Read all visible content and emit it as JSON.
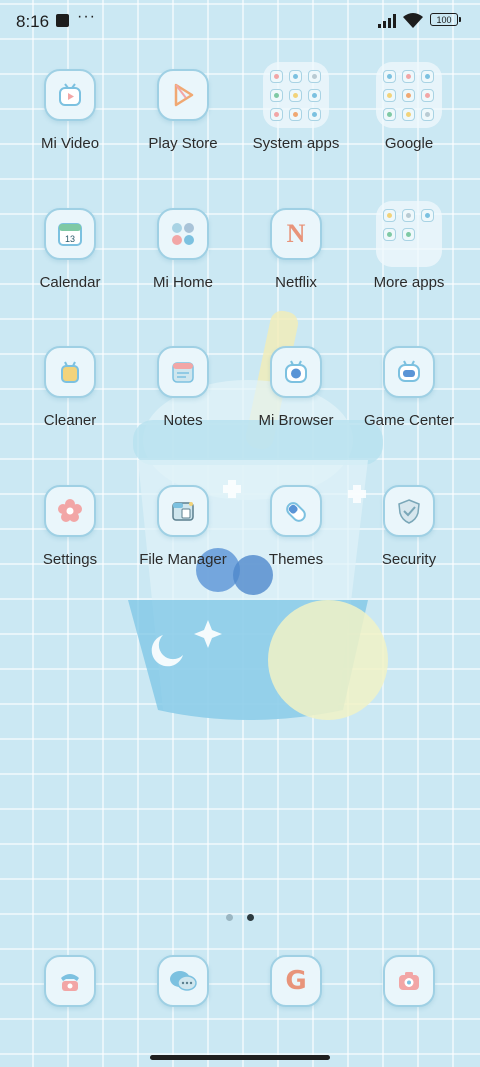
{
  "status_bar": {
    "time": "8:16",
    "more_glyph": "···",
    "battery": "100"
  },
  "home": {
    "rows": [
      [
        {
          "label": "Mi Video",
          "icon": "mi-video-icon"
        },
        {
          "label": "Play Store",
          "icon": "play-store-icon"
        },
        {
          "label": "System apps",
          "icon": "folder-icon"
        },
        {
          "label": "Google",
          "icon": "folder-icon"
        }
      ],
      [
        {
          "label": "Calendar",
          "icon": "calendar-icon",
          "date": "13"
        },
        {
          "label": "Mi Home",
          "icon": "mi-home-icon"
        },
        {
          "label": "Netflix",
          "icon": "netflix-icon",
          "glyph": "N"
        },
        {
          "label": "More apps",
          "icon": "folder-icon"
        }
      ],
      [
        {
          "label": "Cleaner",
          "icon": "cleaner-icon"
        },
        {
          "label": "Notes",
          "icon": "notes-icon"
        },
        {
          "label": "Mi Browser",
          "icon": "browser-icon"
        },
        {
          "label": "Game Center",
          "icon": "game-center-icon"
        }
      ],
      [
        {
          "label": "Settings",
          "icon": "flower-settings-icon"
        },
        {
          "label": "File Manager",
          "icon": "file-manager-icon"
        },
        {
          "label": "Themes",
          "icon": "themes-icon"
        },
        {
          "label": "Security",
          "icon": "shield-icon"
        }
      ]
    ]
  },
  "pager": {
    "page_count": 2,
    "active_page": 2
  },
  "dock": {
    "phone_icon": "phone-icon",
    "messages_icon": "messages-icon",
    "chrome_icon": "google-g-icon",
    "chrome_glyph": "G",
    "camera_icon": "camera-icon"
  },
  "colors": {
    "background": "#cbe8f3",
    "icon_border": "#9fd0e4",
    "icon_fill": "#eaf6fb",
    "accent_pink": "#f2a6a6",
    "accent_blue": "#7cc1e0"
  }
}
